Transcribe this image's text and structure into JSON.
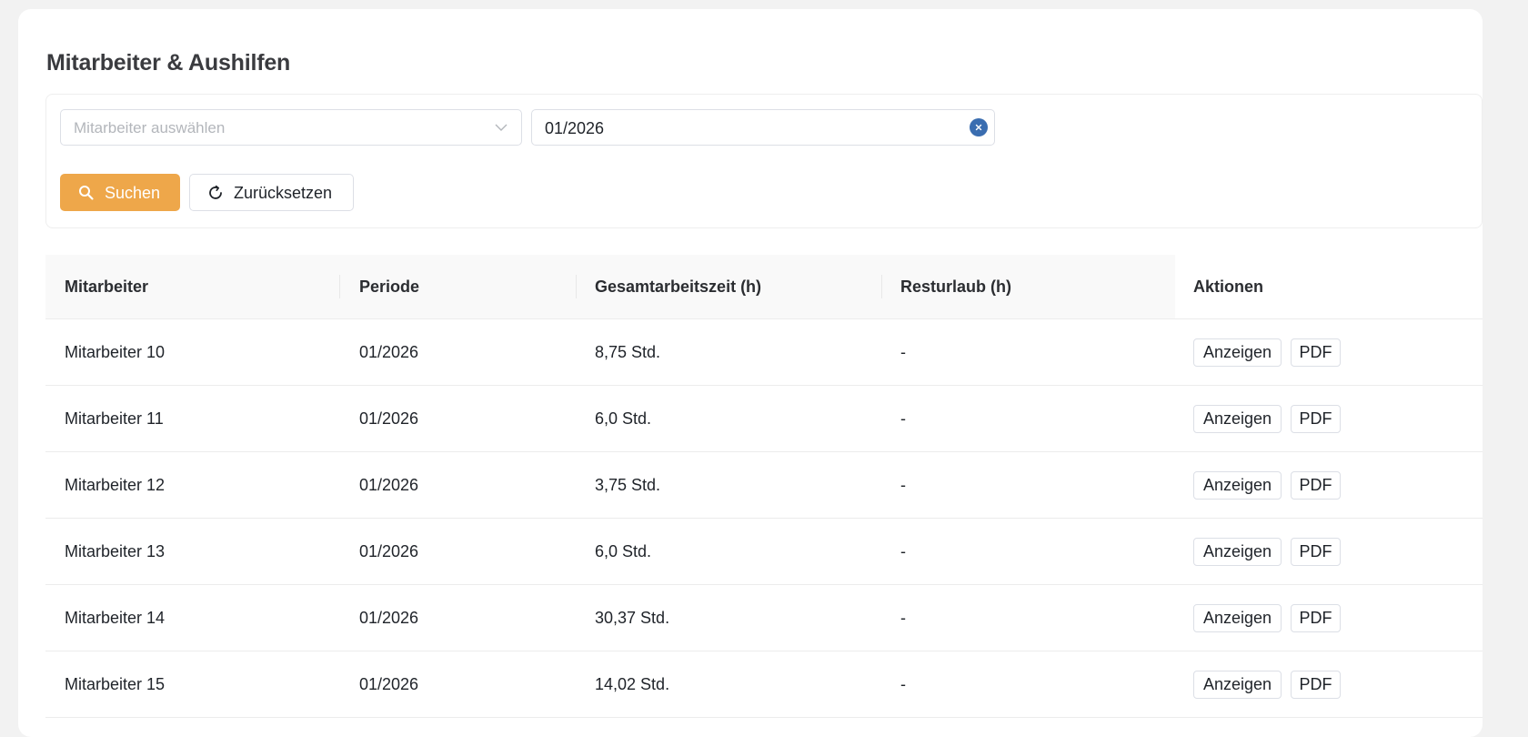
{
  "page": {
    "title": "Mitarbeiter & Aushilfen"
  },
  "filters": {
    "employee_select_placeholder": "Mitarbeiter auswählen",
    "period_value": "01/2026",
    "search_label": "Suchen",
    "reset_label": "Zurücksetzen"
  },
  "colors": {
    "primary": "#eea74a",
    "clear_icon": "#3a6db0"
  },
  "table": {
    "columns": [
      "Mitarbeiter",
      "Periode",
      "Gesamtarbeitszeit (h)",
      "Resturlaub (h)",
      "Aktionen"
    ],
    "rows": [
      {
        "name": "Mitarbeiter 10",
        "period": "01/2026",
        "hours": "8,75 Std.",
        "vacation": "-",
        "view": "Anzeigen",
        "pdf": "PDF"
      },
      {
        "name": "Mitarbeiter 11",
        "period": "01/2026",
        "hours": "6,0 Std.",
        "vacation": "-",
        "view": "Anzeigen",
        "pdf": "PDF"
      },
      {
        "name": "Mitarbeiter 12",
        "period": "01/2026",
        "hours": "3,75 Std.",
        "vacation": "-",
        "view": "Anzeigen",
        "pdf": "PDF"
      },
      {
        "name": "Mitarbeiter 13",
        "period": "01/2026",
        "hours": "6,0 Std.",
        "vacation": "-",
        "view": "Anzeigen",
        "pdf": "PDF"
      },
      {
        "name": "Mitarbeiter 14",
        "period": "01/2026",
        "hours": "30,37 Std.",
        "vacation": "-",
        "view": "Anzeigen",
        "pdf": "PDF"
      },
      {
        "name": "Mitarbeiter 15",
        "period": "01/2026",
        "hours": "14,02 Std.",
        "vacation": "-",
        "view": "Anzeigen",
        "pdf": "PDF"
      }
    ]
  }
}
